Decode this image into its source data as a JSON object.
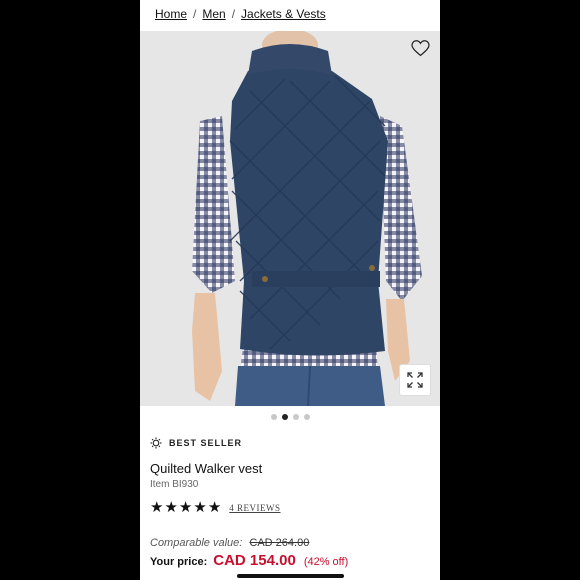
{
  "breadcrumb": {
    "items": [
      "Home",
      "Men",
      "Jackets & Vests"
    ],
    "separator": "/"
  },
  "product": {
    "image_alt": "Quilted Walker vest back view",
    "wishlist_icon": "heart-icon",
    "expand_icon": "expand-icon",
    "carousel": {
      "count": 4,
      "active_index": 1
    },
    "badge": "BEST SELLER",
    "name": "Quilted Walker vest",
    "item_number": "Item BI930",
    "rating": {
      "stars": 5,
      "reviews_label": "4 REVIEWS"
    },
    "comparable_label": "Comparable value:",
    "comparable_price": "CAD 264.00",
    "price_label": "Your price:",
    "price": "CAD 154.00",
    "discount": "(42% off)"
  },
  "colors": {
    "price_red": "#c8102e",
    "vest_navy": "#2f4566"
  }
}
